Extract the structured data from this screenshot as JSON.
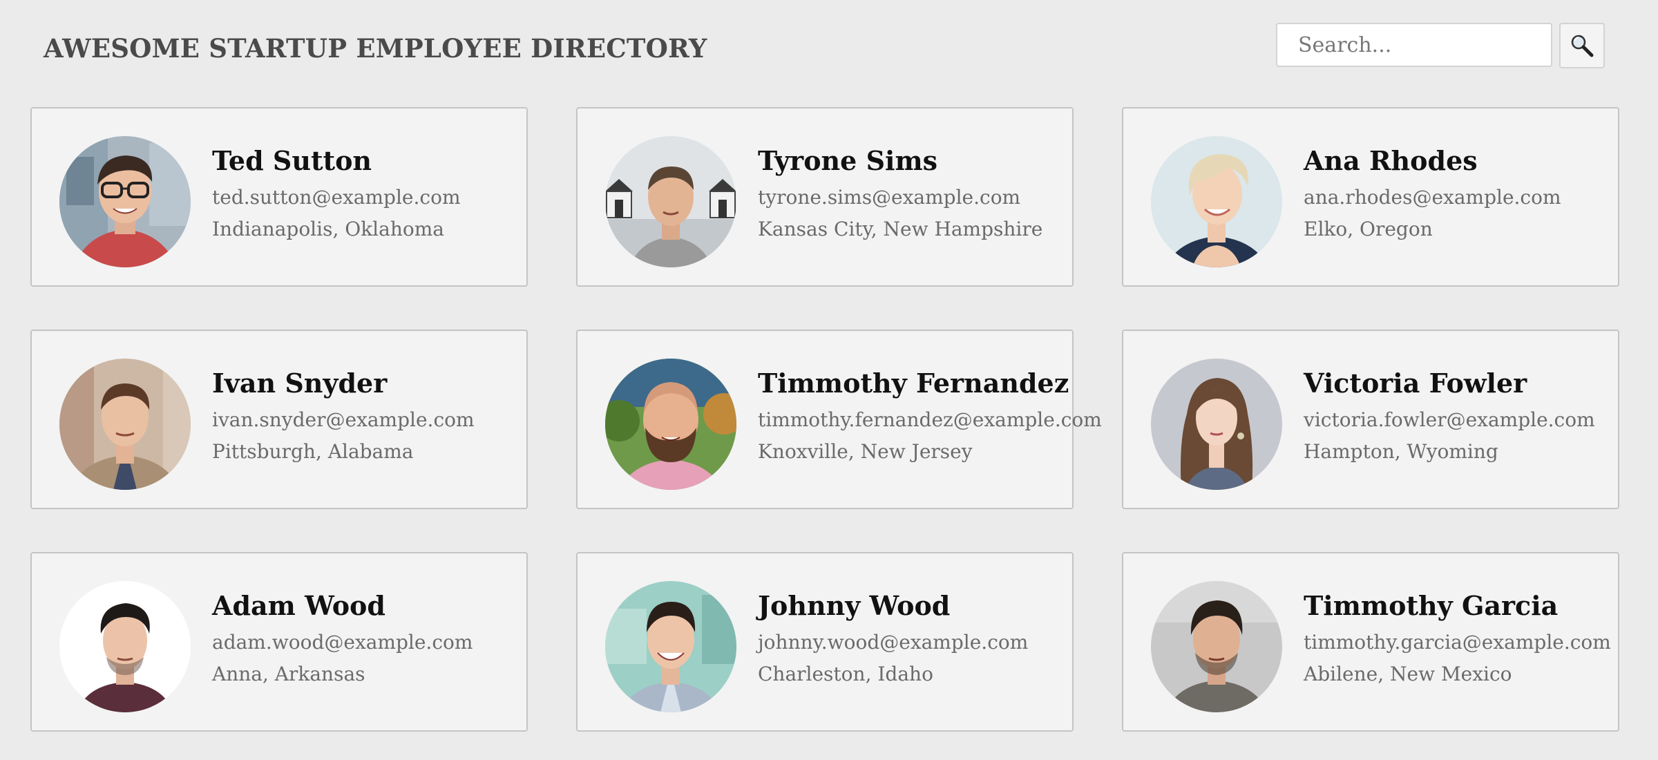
{
  "header": {
    "title": "AWESOME STARTUP EMPLOYEE DIRECTORY",
    "search_placeholder": "Search...",
    "search_icon": "magnifying-glass-icon"
  },
  "employees": [
    {
      "name": "Ted Sutton",
      "email": "ted.sutton@example.com",
      "location": "Indianapolis, Oklahoma",
      "avatar": "avatar-photo-man-glasses"
    },
    {
      "name": "Tyrone Sims",
      "email": "tyrone.sims@example.com",
      "location": "Kansas City, New Hampshire",
      "avatar": "avatar-photo-man-beach-huts"
    },
    {
      "name": "Ana Rhodes",
      "email": "ana.rhodes@example.com",
      "location": "Elko, Oregon",
      "avatar": "avatar-photo-woman-blonde-short"
    },
    {
      "name": "Ivan Snyder",
      "email": "ivan.snyder@example.com",
      "location": "Pittsburgh, Alabama",
      "avatar": "avatar-photo-man-blazer"
    },
    {
      "name": "Timmothy Fernandez",
      "email": "timmothy.fernandez@example.com",
      "location": "Knoxville, New Jersey",
      "avatar": "avatar-photo-man-beard-bald"
    },
    {
      "name": "Victoria Fowler",
      "email": "victoria.fowler@example.com",
      "location": "Hampton, Wyoming",
      "avatar": "avatar-photo-woman-long-hair"
    },
    {
      "name": "Adam Wood",
      "email": "adam.wood@example.com",
      "location": "Anna, Arkansas",
      "avatar": "avatar-photo-man-white-background"
    },
    {
      "name": "Johnny Wood",
      "email": "johnny.wood@example.com",
      "location": "Charleston, Idaho",
      "avatar": "avatar-photo-man-smiling-blue-wall"
    },
    {
      "name": "Timmothy Garcia",
      "email": "timmothy.garcia@example.com",
      "location": "Abilene, New Mexico",
      "avatar": "avatar-photo-man-stubble-grey"
    }
  ]
}
